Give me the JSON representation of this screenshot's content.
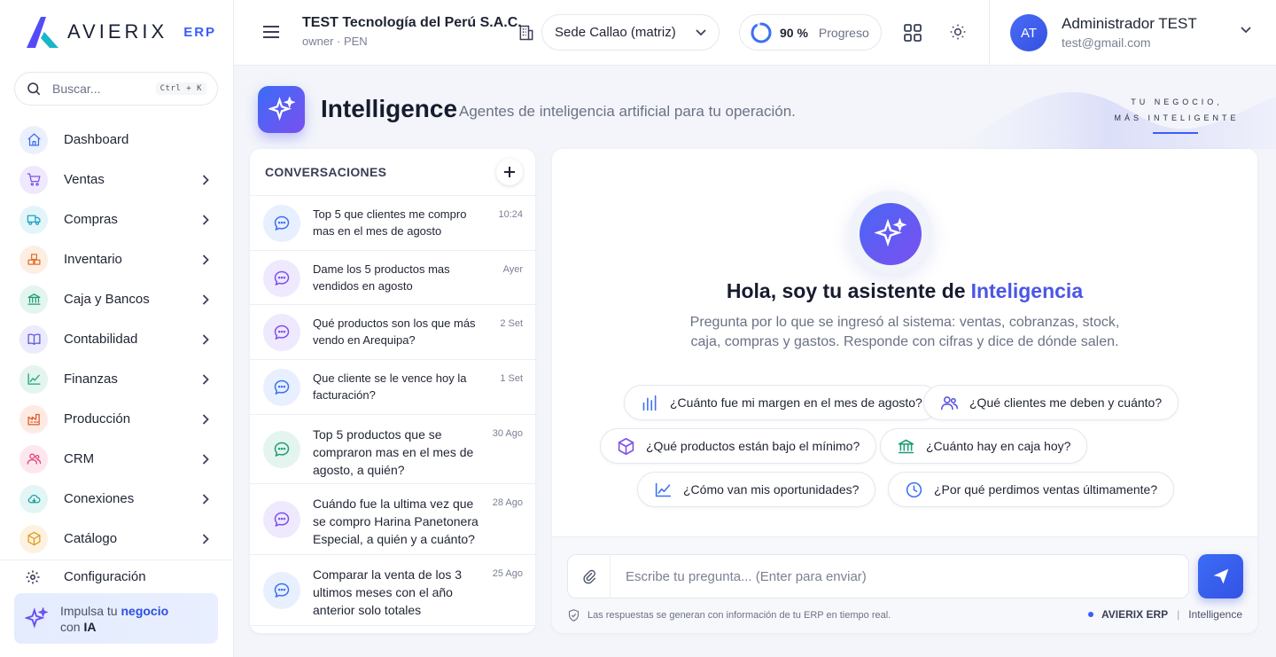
{
  "brand": {
    "name": "AVIERIX",
    "suffix": "ERP"
  },
  "search": {
    "placeholder": "Buscar...",
    "shortcut": "Ctrl + K"
  },
  "sidebar": {
    "items": [
      {
        "label": "Dashboard",
        "icon": "home-icon",
        "color": "#3b6ff5",
        "bg": "#eaf0fe",
        "chevron": false
      },
      {
        "label": "Ventas",
        "icon": "cart-icon",
        "color": "#7c4ff0",
        "bg": "#efe9fd",
        "chevron": true
      },
      {
        "label": "Compras",
        "icon": "truck-icon",
        "color": "#1aa3c0",
        "bg": "#e3f5f9",
        "chevron": true
      },
      {
        "label": "Inventario",
        "icon": "boxes-icon",
        "color": "#e0702b",
        "bg": "#fdeee3",
        "chevron": true
      },
      {
        "label": "Caja y Bancos",
        "icon": "bank-icon",
        "color": "#1f9d76",
        "bg": "#e3f5ee",
        "chevron": true
      },
      {
        "label": "Contabilidad",
        "icon": "book-icon",
        "color": "#5a55e0",
        "bg": "#eceafd",
        "chevron": true
      },
      {
        "label": "Finanzas",
        "icon": "trend-icon",
        "color": "#1aa37a",
        "bg": "#e3f5ee",
        "chevron": true
      },
      {
        "label": "Producción",
        "icon": "factory-icon",
        "color": "#e05a2b",
        "bg": "#fdebe3",
        "chevron": true
      },
      {
        "label": "CRM",
        "icon": "users-icon",
        "color": "#e0457a",
        "bg": "#fde6ee",
        "chevron": true
      },
      {
        "label": "Conexiones",
        "icon": "cloud-icon",
        "color": "#1aa3a0",
        "bg": "#e3f5f5",
        "chevron": true
      },
      {
        "label": "Catálogo",
        "icon": "package-icon",
        "color": "#e09a1b",
        "bg": "#fdf2e0",
        "chevron": true
      }
    ],
    "config_label": "Configuración",
    "promo": {
      "prefix": "Impulsa tu",
      "highlight": "negocio",
      "con": "con",
      "ia": "IA"
    }
  },
  "topbar": {
    "company_name": "TEST Tecnología del Perú S.A.C.",
    "company_sub": "owner · PEN",
    "sede": "Sede Callao (matriz)",
    "progress_value": "90 %",
    "progress_fraction": 0.9,
    "progress_label": "Progreso",
    "user_initials": "AT",
    "user_name": "Administrador TEST",
    "user_email": "test@gmail.com"
  },
  "header": {
    "title": "Intelligence",
    "subtitle": "Agentes de inteligencia artificial para tu operación.",
    "tagline_1": "TU NEGOCIO,",
    "tagline_2": "MÁS INTELIGENTE"
  },
  "conversations": {
    "title": "CONVERSACIONES",
    "items": [
      {
        "text": "Top 5 que clientes me compro mas en el mes de agosto",
        "time": "10:24",
        "bub": "#e8efff",
        "ic": "#3b6ff5"
      },
      {
        "text": "Dame los 5 productos mas vendidos en agosto",
        "time": "Ayer",
        "bub": "#efe9fd",
        "ic": "#7c4ff0"
      },
      {
        "text": "Qué productos son los que más vendo en Arequipa?",
        "time": "2 Set",
        "bub": "#efe9fd",
        "ic": "#7c4ff0"
      },
      {
        "text": "Que cliente se le vence hoy la facturación?",
        "time": "1 Set",
        "bub": "#e8efff",
        "ic": "#3b6ff5"
      },
      {
        "text": "Top 5 productos que se compraron mas en el mes de agosto, a quién?",
        "time": "30 Ago",
        "bub": "#e3f5ee",
        "ic": "#1f9d76"
      },
      {
        "text": "Cuándo fue la ultima vez que se compro Harina Panetonera Especial, a quién y a cuánto?",
        "time": "28 Ago",
        "bub": "#efe9fd",
        "ic": "#7c4ff0"
      },
      {
        "text": "Comparar la venta de los 3 ultimos meses con el año anterior solo totales",
        "time": "25 Ago",
        "bub": "#e8efff",
        "ic": "#3b6ff5"
      }
    ]
  },
  "chat": {
    "greeting": "Hola, soy tu asistente de",
    "greeting_highlight": "Inteligencia",
    "intro": "Pregunta por lo que se ingresó al sistema: ventas, cobranzas, stock, caja, compras y gastos. Responde con cifras y dice de dónde salen.",
    "suggestions": [
      {
        "label": "¿Cuánto fue mi margen en el mes de agosto?",
        "icon": "bar-chart-icon",
        "color": "#3b6ff5"
      },
      {
        "label": "¿Qué clientes me deben y cuánto?",
        "icon": "users-icon",
        "color": "#5a55e0"
      },
      {
        "label": "¿Qué productos están bajo el mínimo?",
        "icon": "cube-icon",
        "color": "#7c4ff0"
      },
      {
        "label": "¿Cuánto hay en caja hoy?",
        "icon": "bank-icon",
        "color": "#1f9d76"
      },
      {
        "label": "¿Cómo van mis oportunidades?",
        "icon": "trend-icon",
        "color": "#3b6ff5"
      },
      {
        "label": "¿Por qué perdimos ventas últimamente?",
        "icon": "clock-icon",
        "color": "#3b6ff5"
      }
    ],
    "input_placeholder": "Escribe tu pregunta... (Enter para enviar)",
    "footer_note": "Las respuestas se generan con información de tu ERP en tiempo real.",
    "footer_brand": "AVIERIX ERP",
    "footer_module": "Intelligence"
  }
}
